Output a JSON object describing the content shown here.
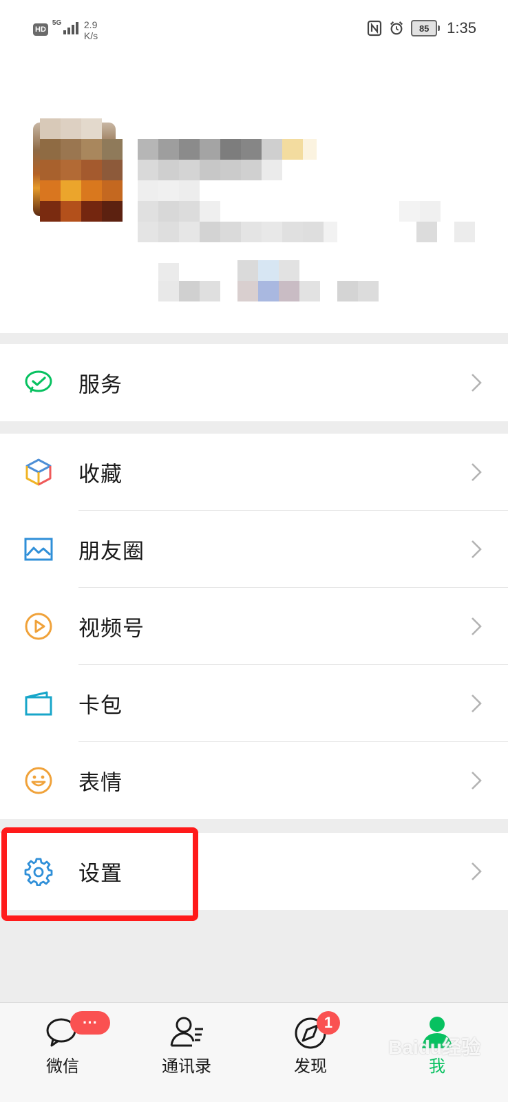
{
  "status_bar": {
    "hd": "HD",
    "network": "5G",
    "speed_value": "2.9",
    "speed_unit": "K/s",
    "battery": "85",
    "time": "1:35"
  },
  "menu": {
    "service": "服务",
    "favorites": "收藏",
    "moments": "朋友圈",
    "channels": "视频号",
    "cards": "卡包",
    "stickers": "表情",
    "settings": "设置"
  },
  "tabbar": {
    "chats": "微信",
    "chats_badge": "···",
    "contacts": "通讯录",
    "discover": "发现",
    "discover_badge": "1",
    "me": "我"
  },
  "colors": {
    "accent": "#07c160",
    "badge": "#fa5151",
    "highlight": "#ff1a1a"
  },
  "watermark": "Baidu经验"
}
